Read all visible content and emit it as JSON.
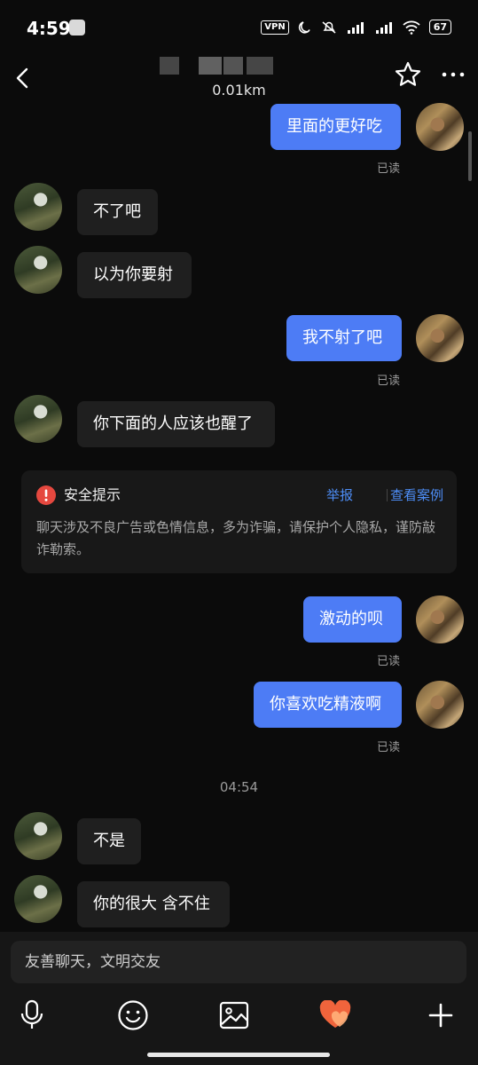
{
  "status_bar": {
    "time": "4:59",
    "vpn": "VPN",
    "battery": "67"
  },
  "header": {
    "distance": "0.01km"
  },
  "messages": [
    {
      "text": "里面的更好吃",
      "read": "已读"
    },
    {
      "text": "不了吧"
    },
    {
      "text": "以为你要射"
    },
    {
      "text": "我不射了吧",
      "read": "已读"
    },
    {
      "text": "你下面的人应该也醒了"
    },
    {
      "text": "激动的呗",
      "read": "已读"
    },
    {
      "text": "你喜欢吃精液啊",
      "read": "已读"
    },
    {
      "text": "不是"
    },
    {
      "text": "你的很大 含不住"
    }
  ],
  "safety_notice": {
    "title": "安全提示",
    "report": "举报",
    "view_cases": "查看案例",
    "body": "聊天涉及不良广告或色情信息，多为诈骗，请保护个人隐私，谨防敲诈勒索。"
  },
  "timestamp": "04:54",
  "input": {
    "placeholder": "友善聊天，文明交友"
  },
  "colors": {
    "outgoing_bubble": "#4d7cf5",
    "incoming_bubble": "#1f1f1f",
    "link": "#4d8df6",
    "warning": "#e5483f",
    "heart": "#f0643c"
  },
  "icons": [
    "back-icon",
    "star-icon",
    "more-icon",
    "warning-icon",
    "microphone-icon",
    "emoji-icon",
    "image-icon",
    "heart-icon",
    "plus-icon"
  ]
}
